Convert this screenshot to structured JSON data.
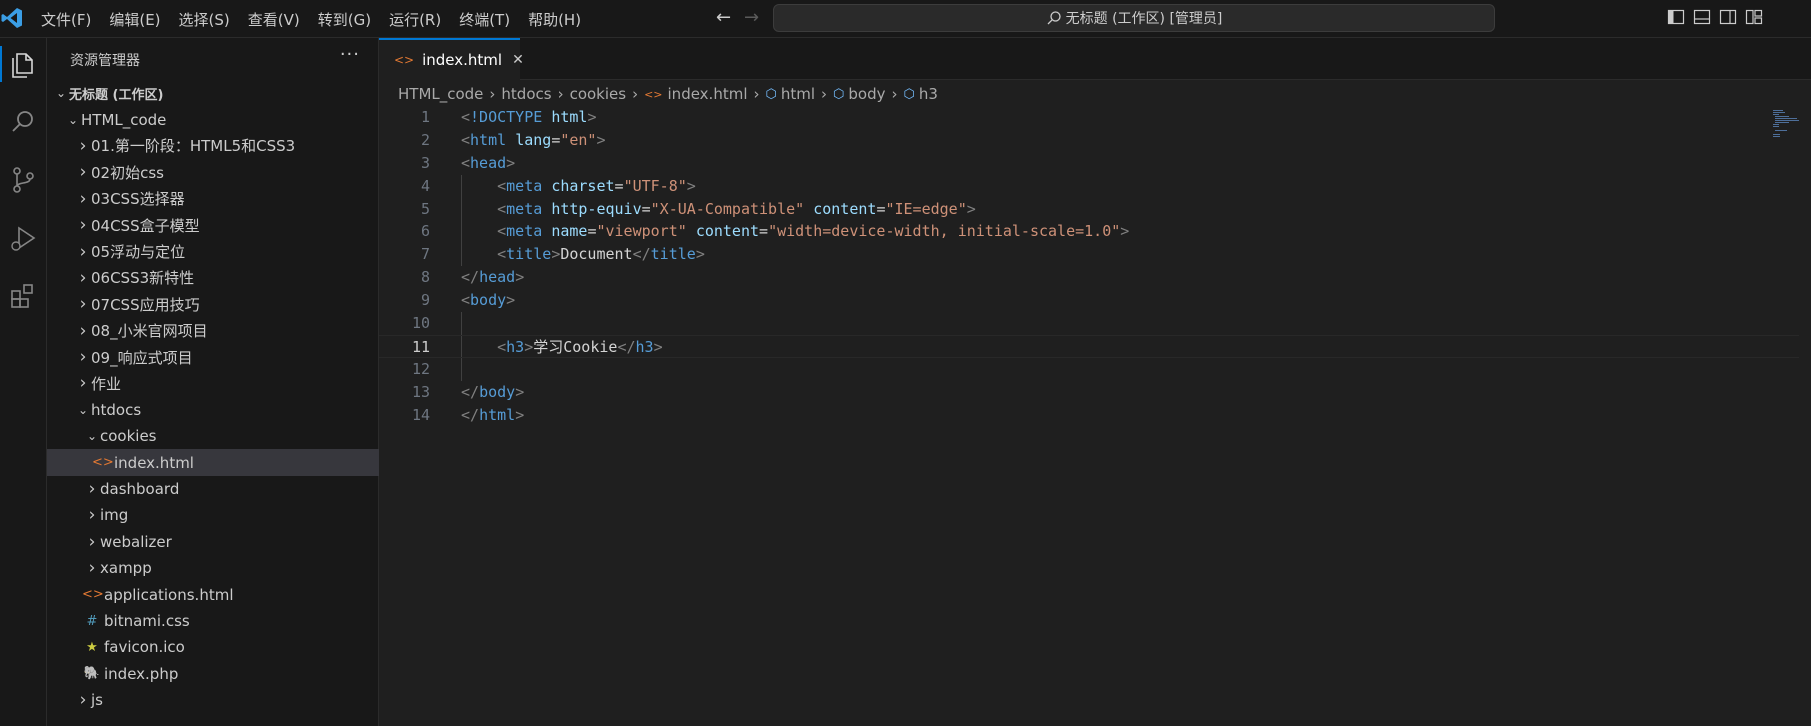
{
  "menu": [
    "文件(F)",
    "编辑(E)",
    "选择(S)",
    "查看(V)",
    "转到(G)",
    "运行(R)",
    "终端(T)",
    "帮助(H)"
  ],
  "search": {
    "text": "无标题 (工作区) [管理员]"
  },
  "sidebar": {
    "title": "资源管理器",
    "more": "···",
    "workspace": "无标题 (工作区)",
    "root": "HTML_code",
    "folders": [
      "01.第一阶段：HTML5和CSS3",
      "02初始css",
      "03CSS选择器",
      "04CSS盒子模型",
      "05浮动与定位",
      "06CSS3新特性",
      "07CSS应用技巧",
      "08_小米官网项目",
      "09_响应式项目",
      "作业"
    ],
    "htdocs": "htdocs",
    "cookies": "cookies",
    "selected_file": "index.html",
    "htdocs_folders": [
      "dashboard",
      "img",
      "webalizer",
      "xampp"
    ],
    "files": [
      {
        "name": "applications.html",
        "icon": "html-file-icon",
        "glyph": "<>",
        "color": "#e37933"
      },
      {
        "name": "bitnami.css",
        "icon": "css-file-icon",
        "glyph": "#",
        "color": "#519aba"
      },
      {
        "name": "favicon.ico",
        "icon": "star-icon",
        "glyph": "★",
        "color": "#cbcb41"
      },
      {
        "name": "index.php",
        "icon": "php-file-icon",
        "glyph": "🐘",
        "color": "#a074c4"
      }
    ],
    "last_folder": "js"
  },
  "tab": {
    "label": "index.html",
    "close": "✕"
  },
  "breadcrumb": [
    "HTML_code",
    "htdocs",
    "cookies",
    "index.html",
    "html",
    "body",
    "h3"
  ],
  "code": {
    "current_line": 11,
    "lines": [
      {
        "n": "1",
        "html": "<span class=\"p\">&lt;</span><span class=\"t\">!DOCTYPE</span> <span class=\"a\">html</span><span class=\"p\">&gt;</span>"
      },
      {
        "n": "2",
        "html": "<span class=\"p\">&lt;</span><span class=\"t\">html</span> <span class=\"a\">lang</span><span class=\"w\">=</span><span class=\"s\">\"en\"</span><span class=\"p\">&gt;</span>"
      },
      {
        "n": "3",
        "html": "<span class=\"p\">&lt;</span><span class=\"t\">head</span><span class=\"p\">&gt;</span>"
      },
      {
        "n": "4",
        "html": "    <span class=\"p\">&lt;</span><span class=\"t\">meta</span> <span class=\"a\">charset</span><span class=\"w\">=</span><span class=\"s\">\"UTF-8\"</span><span class=\"p\">&gt;</span>"
      },
      {
        "n": "5",
        "html": "    <span class=\"p\">&lt;</span><span class=\"t\">meta</span> <span class=\"a\">http-equiv</span><span class=\"w\">=</span><span class=\"s\">\"X-UA-Compatible\"</span> <span class=\"a\">content</span><span class=\"w\">=</span><span class=\"s\">\"IE=edge\"</span><span class=\"p\">&gt;</span>"
      },
      {
        "n": "6",
        "html": "    <span class=\"p\">&lt;</span><span class=\"t\">meta</span> <span class=\"a\">name</span><span class=\"w\">=</span><span class=\"s\">\"viewport\"</span> <span class=\"a\">content</span><span class=\"w\">=</span><span class=\"s\">\"width=device-width, initial-scale=1.0\"</span><span class=\"p\">&gt;</span>"
      },
      {
        "n": "7",
        "html": "    <span class=\"p\">&lt;</span><span class=\"t\">title</span><span class=\"p\">&gt;</span><span class=\"w\">Document</span><span class=\"p\">&lt;/</span><span class=\"t\">title</span><span class=\"p\">&gt;</span>"
      },
      {
        "n": "8",
        "html": "<span class=\"p\">&lt;/</span><span class=\"t\">head</span><span class=\"p\">&gt;</span>"
      },
      {
        "n": "9",
        "html": "<span class=\"p\">&lt;</span><span class=\"t\">body</span><span class=\"p\">&gt;</span>"
      },
      {
        "n": "10",
        "html": ""
      },
      {
        "n": "11",
        "html": "    <span class=\"p\">&lt;</span><span class=\"t\">h3</span><span class=\"p\">&gt;</span><span class=\"w\">学习Cookie</span><span class=\"p\">&lt;/</span><span class=\"t\">h3</span><span class=\"p\">&gt;</span>"
      },
      {
        "n": "12",
        "html": ""
      },
      {
        "n": "13",
        "html": "<span class=\"p\">&lt;/</span><span class=\"t\">body</span><span class=\"p\">&gt;</span>"
      },
      {
        "n": "14",
        "html": "<span class=\"p\">&lt;/</span><span class=\"t\">html</span><span class=\"p\">&gt;</span>"
      }
    ]
  },
  "colors": {
    "accent": "#0078d4",
    "html_icon": "#e37933",
    "tag": "#569cd6",
    "attribute": "#9cdcfe",
    "string": "#ce9178"
  }
}
